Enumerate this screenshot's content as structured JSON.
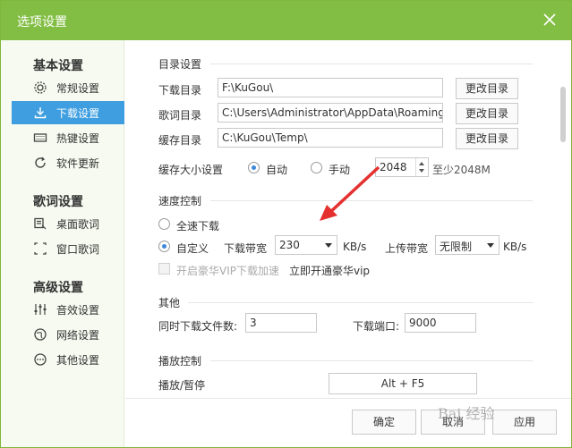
{
  "window": {
    "title": "选项设置",
    "accent": "#82be44",
    "highlight": "#3e9ee0"
  },
  "sidebar": {
    "groups": [
      {
        "title": "基本设置",
        "items": [
          {
            "label": "常规设置",
            "icon": "gear-icon"
          },
          {
            "label": "下载设置",
            "icon": "download-icon",
            "active": true
          },
          {
            "label": "热键设置",
            "icon": "keyboard-icon"
          },
          {
            "label": "软件更新",
            "icon": "refresh-icon"
          }
        ]
      },
      {
        "title": "歌词设置",
        "items": [
          {
            "label": "桌面歌词",
            "icon": "desktop-lyrics-icon"
          },
          {
            "label": "窗口歌词",
            "icon": "window-lyrics-icon"
          }
        ]
      },
      {
        "title": "高级设置",
        "items": [
          {
            "label": "音效设置",
            "icon": "equalizer-icon"
          },
          {
            "label": "网络设置",
            "icon": "globe-icon"
          },
          {
            "label": "其他设置",
            "icon": "more-icon"
          }
        ]
      }
    ]
  },
  "directory": {
    "title": "目录设置",
    "download_label": "下载目录",
    "download_value": "F:\\KuGou\\",
    "lyrics_label": "歌词目录",
    "lyrics_value": "C:\\Users\\Administrator\\AppData\\Roaming",
    "cache_label": "缓存目录",
    "cache_value": "C:\\KuGou\\Temp\\",
    "change_button": "更改目录",
    "cache_size_label": "缓存大小设置",
    "auto_label": "自动",
    "manual_label": "手动",
    "cache_size_value": "2048",
    "cache_size_hint": "至少2048M"
  },
  "speed": {
    "title": "速度控制",
    "full_speed_label": "全速下载",
    "custom_label": "自定义",
    "download_bw_label": "下载带宽",
    "download_bw_value": "230",
    "unit": "KB/s",
    "upload_bw_label": "上传带宽",
    "upload_bw_value": "无限制",
    "vip_accel_label": "开启豪华VIP下载加速",
    "vip_link": "立即开通豪华vip"
  },
  "other": {
    "title": "其他",
    "concurrent_label": "同时下载文件数:",
    "concurrent_value": "3",
    "port_label": "下载端口:",
    "port_value": "9000"
  },
  "playback": {
    "title": "播放控制",
    "play_pause_label": "播放/暂停",
    "play_pause_hotkey": "Alt + F5"
  },
  "footer": {
    "ok": "确定",
    "cancel": "取消",
    "apply": "应用"
  },
  "watermark": "Bai 经验"
}
